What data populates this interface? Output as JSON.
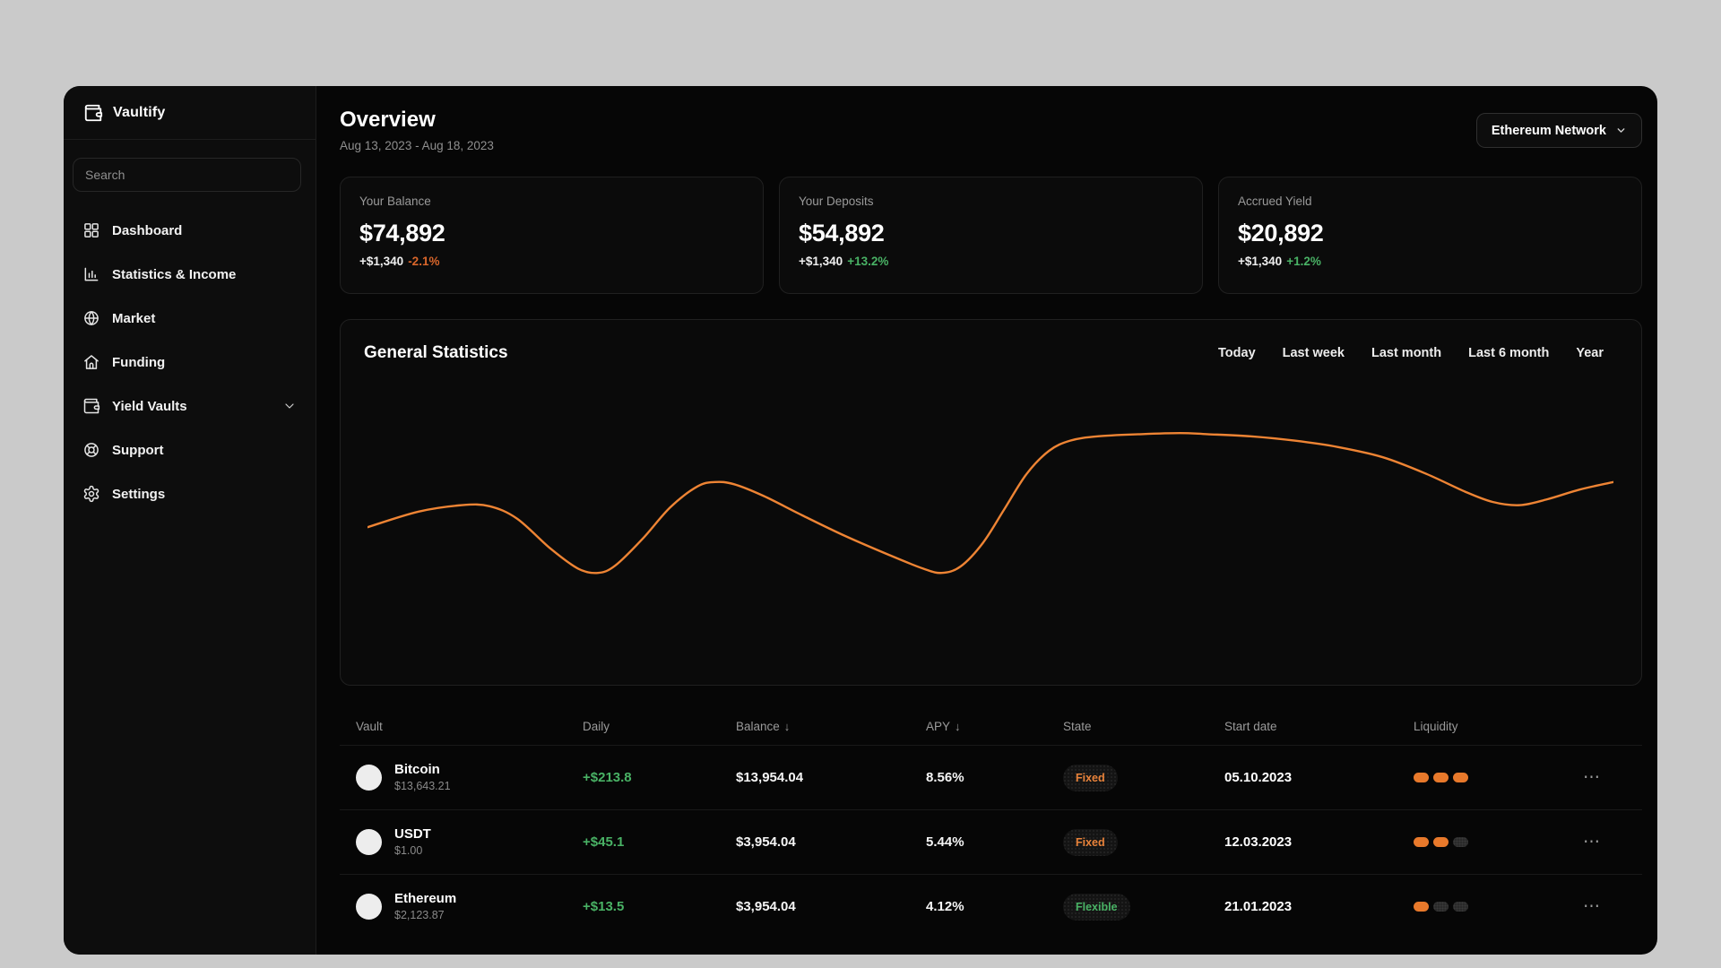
{
  "app": {
    "name": "Vaultify"
  },
  "colors": {
    "accent_orange": "#ee8434",
    "positive_green": "#49b265",
    "negative_orange": "#d9662b",
    "liquidity_on": "#e8792b",
    "liquidity_off": "#2a2a2a"
  },
  "sidebar": {
    "search_placeholder": "Search",
    "items": [
      {
        "id": "dashboard",
        "label": "Dashboard",
        "icon": "dashboard-icon"
      },
      {
        "id": "statistics",
        "label": "Statistics & Income",
        "icon": "bar-chart-icon"
      },
      {
        "id": "market",
        "label": "Market",
        "icon": "globe-icon"
      },
      {
        "id": "funding",
        "label": "Funding",
        "icon": "home-icon"
      },
      {
        "id": "yield-vaults",
        "label": "Yield Vaults",
        "icon": "wallet-icon",
        "expandable": true
      },
      {
        "id": "support",
        "label": "Support",
        "icon": "lifebuoy-icon"
      },
      {
        "id": "settings",
        "label": "Settings",
        "icon": "gear-icon"
      }
    ]
  },
  "header": {
    "title": "Overview",
    "date_range": "Aug 13, 2023 - Aug 18, 2023",
    "network_selector": "Ethereum Network"
  },
  "stat_cards": [
    {
      "label": "Your Balance",
      "value": "$74,892",
      "delta": "+$1,340",
      "delta_pct": "-2.1%",
      "delta_pct_color": "#d9662b"
    },
    {
      "label": "Your Deposits",
      "value": "$54,892",
      "delta": "+$1,340",
      "delta_pct": "+13.2%",
      "delta_pct_color": "#49b265"
    },
    {
      "label": "Accrued Yield",
      "value": "$20,892",
      "delta": "+$1,340",
      "delta_pct": "+1.2%",
      "delta_pct_color": "#49b265"
    }
  ],
  "statistics_panel": {
    "title": "General Statistics",
    "filters": [
      "Today",
      "Last week",
      "Last month",
      "Last 6 month",
      "Year"
    ]
  },
  "chart_data": {
    "type": "line",
    "title": "General Statistics",
    "axes_labeled": false,
    "grid": false,
    "x_range": [
      0,
      1000
    ],
    "y_range": [
      0,
      300
    ],
    "y_inverted_screen_units": true,
    "series": [
      {
        "name": "portfolio-performance",
        "color": "#ee8434",
        "points": [
          [
            0,
            192
          ],
          [
            41,
            163
          ],
          [
            76,
            151
          ],
          [
            98,
            153
          ],
          [
            120,
            176
          ],
          [
            147,
            232
          ],
          [
            169,
            269
          ],
          [
            185,
            277
          ],
          [
            199,
            263
          ],
          [
            221,
            213
          ],
          [
            243,
            155
          ],
          [
            265,
            116
          ],
          [
            279,
            108
          ],
          [
            294,
            112
          ],
          [
            318,
            134
          ],
          [
            349,
            170
          ],
          [
            384,
            209
          ],
          [
            419,
            244
          ],
          [
            446,
            269
          ],
          [
            461,
            277
          ],
          [
            476,
            265
          ],
          [
            494,
            221
          ],
          [
            511,
            159
          ],
          [
            529,
            93
          ],
          [
            547,
            50
          ],
          [
            564,
            31
          ],
          [
            586,
            23
          ],
          [
            621,
            19
          ],
          [
            652,
            17
          ],
          [
            674,
            19
          ],
          [
            709,
            23
          ],
          [
            744,
            31
          ],
          [
            779,
            43
          ],
          [
            815,
            62
          ],
          [
            850,
            93
          ],
          [
            881,
            126
          ],
          [
            903,
            145
          ],
          [
            925,
            151
          ],
          [
            947,
            140
          ],
          [
            973,
            122
          ],
          [
            1000,
            108
          ]
        ]
      }
    ]
  },
  "table": {
    "columns": [
      {
        "label": "Vault",
        "sort": null
      },
      {
        "label": "Daily",
        "sort": null
      },
      {
        "label": "Balance",
        "sort": "desc"
      },
      {
        "label": "APY",
        "sort": "desc"
      },
      {
        "label": "State",
        "sort": null
      },
      {
        "label": "Start date",
        "sort": null
      },
      {
        "label": "Liquidity",
        "sort": null
      }
    ],
    "rows": [
      {
        "vault": "Bitcoin",
        "price": "$13,643.21",
        "daily": "+$213.8",
        "balance": "$13,954.04",
        "apy": "8.56%",
        "state": "Fixed",
        "state_color": "#e8823a",
        "start_date": "05.10.2023",
        "liquidity_filled": 3,
        "liquidity_total": 3,
        "menu": "⋯"
      },
      {
        "vault": "USDT",
        "price": "$1.00",
        "daily": "+$45.1",
        "balance": "$3,954.04",
        "apy": "5.44%",
        "state": "Fixed",
        "state_color": "#e8823a",
        "start_date": "12.03.2023",
        "liquidity_filled": 2,
        "liquidity_total": 3,
        "menu": "⋯"
      },
      {
        "vault": "Ethereum",
        "price": "$2,123.87",
        "daily": "+$13.5",
        "balance": "$3,954.04",
        "apy": "4.12%",
        "state": "Flexible",
        "state_color": "#49b265",
        "start_date": "21.01.2023",
        "liquidity_filled": 1,
        "liquidity_total": 3,
        "menu": "⋯"
      }
    ]
  }
}
